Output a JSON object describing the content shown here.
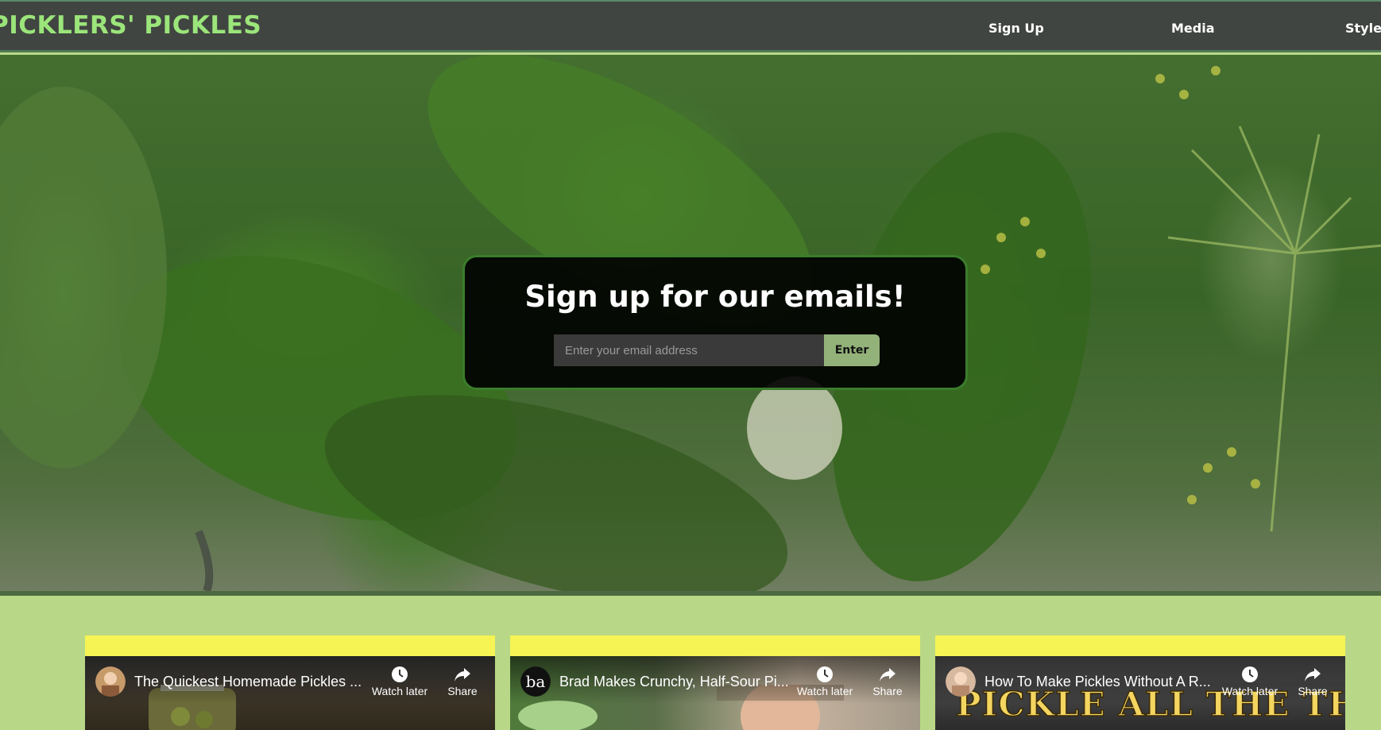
{
  "header": {
    "brand": "PICKLERS' PICKLES",
    "nav": [
      {
        "label": "Sign Up"
      },
      {
        "label": "Media"
      },
      {
        "label": "Styles"
      }
    ]
  },
  "signup": {
    "title": "Sign up for our emails!",
    "email_placeholder": "Enter your email address",
    "email_value": "",
    "button_label": "Enter"
  },
  "videos": [
    {
      "title": "The Quickest Homemade Pickles ...",
      "channel_mark": "",
      "watch_later": "Watch later",
      "share": "Share"
    },
    {
      "title": "Brad Makes Crunchy, Half-Sour Pi...",
      "channel_mark": "ba",
      "watch_later": "Watch later",
      "share": "Share"
    },
    {
      "title": "How To Make Pickles Without A R...",
      "channel_mark": "",
      "watch_later": "Watch later",
      "share": "Share",
      "thumbnail_text": "PICKLE ALL THE THINGS"
    }
  ],
  "colors": {
    "header_bg": "#414541",
    "brand": "#9be57a",
    "page_bg": "#b9d887",
    "accent_button": "#93b27a",
    "video_banner": "#f6f354"
  }
}
